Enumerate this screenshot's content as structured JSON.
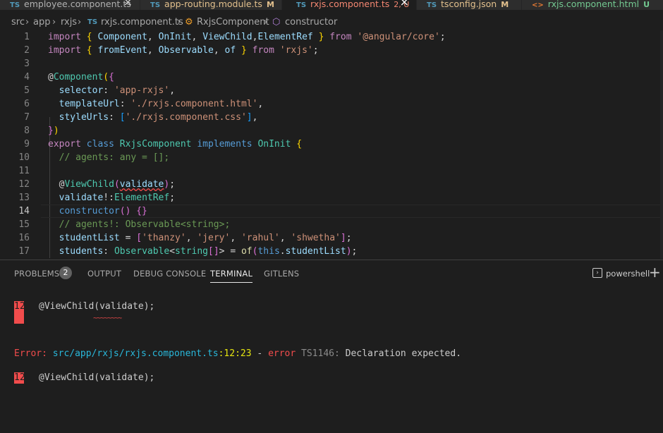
{
  "tabs": [
    {
      "tag": "TS",
      "name": "employee.component.ts",
      "status": "",
      "close": "×"
    },
    {
      "tag": "TS",
      "name": "app-routing.module.ts",
      "status": "M"
    },
    {
      "tag": "TS",
      "name": "rxjs.component.ts",
      "status": "2, U",
      "close": "×"
    },
    {
      "tag": "TS",
      "name": "tsconfig.json",
      "status": "M"
    },
    {
      "tag": "<>",
      "name": "rxjs.component.html",
      "status": "U"
    }
  ],
  "breadcrumb": [
    "src",
    "app",
    "rxjs",
    "TS",
    "rxjs.component.ts",
    "RxjsComponent",
    "constructor"
  ],
  "editor": {
    "line_numbers": [
      "1",
      "2",
      "3",
      "4",
      "5",
      "6",
      "7",
      "8",
      "9",
      "10",
      "11",
      "12",
      "13",
      "14",
      "15",
      "16",
      "17"
    ]
  },
  "panel": {
    "tabs": [
      "PROBLEMS",
      "OUTPUT",
      "DEBUG CONSOLE",
      "TERMINAL",
      "GITLENS"
    ],
    "problems_count": "2",
    "shell": "powershell",
    "add": "+"
  },
  "terminal": {
    "line1_num": "12",
    "line1_code": "@ViewChild(validate);",
    "squiggle": "~~~~~~~~",
    "error_label": "Error:",
    "error_path": "src/app/rxjs/rxjs.component.ts",
    "error_loc": ":12:23",
    "error_dash": " - ",
    "error_word": "error",
    "error_code": "TS1146:",
    "error_msg": "Declaration expected.",
    "line2_num": "12",
    "line2_code": "@ViewChild(validate);"
  },
  "colors": {
    "accent": "#569cd6",
    "error": "#f14c4c",
    "modified": "#e2c08d",
    "untracked": "#73c991"
  }
}
